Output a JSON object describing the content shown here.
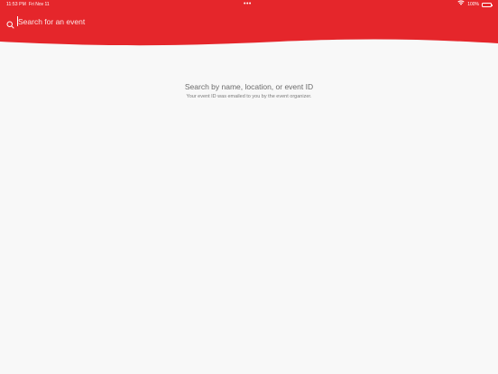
{
  "status_bar": {
    "time": "11:53 PM",
    "date": "Fri Nov 11",
    "dots": "•••",
    "battery_percent": "100%",
    "wifi_icon": "wifi-icon",
    "battery_icon": "battery-icon",
    "battery_level": 1.0
  },
  "search": {
    "placeholder": "Search for an event",
    "value": "",
    "icon": "search-icon"
  },
  "empty_state": {
    "title": "Search by name, location, or event ID",
    "subtitle": "Your event ID was emailed to you by the event organizer."
  },
  "colors": {
    "header_red": "#e5262b",
    "background": "#f8f8f8",
    "text_primary": "#6b6b6b",
    "text_secondary": "#7a7a7a",
    "on_header": "#ffffff"
  }
}
